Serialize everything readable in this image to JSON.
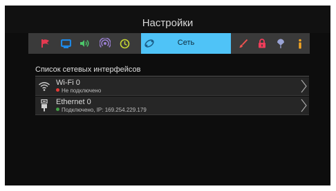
{
  "header": {
    "title": "Настройки"
  },
  "tabs": {
    "active_label": "Сеть",
    "items": [
      {
        "icon": "flag-icon",
        "color": "#e53950"
      },
      {
        "icon": "monitor-icon",
        "color": "#1e88e5"
      },
      {
        "icon": "volume-icon",
        "color": "#4cc86a"
      },
      {
        "icon": "broadcast-icon",
        "color": "#9a7fd1"
      },
      {
        "icon": "clock-icon",
        "color": "#c8d832"
      },
      {
        "icon": "network-icon",
        "color": "#1b5f8a",
        "active": true
      },
      {
        "icon": "brush-icon",
        "color": "#ef5350"
      },
      {
        "icon": "lock-icon",
        "color": "#ef3d5a"
      },
      {
        "icon": "balloon-icon",
        "color": "#9aa4d6"
      },
      {
        "icon": "info-icon",
        "color": "#f5a623"
      }
    ],
    "active_color": "#4fc3f7",
    "bar_color": "#3a3a3a"
  },
  "section": {
    "title": "Список сетевых интерфейсов"
  },
  "interfaces": [
    {
      "icon": "wifi-icon",
      "name": "Wi-Fi 0",
      "status": "Не подключено",
      "status_color": "#e53935"
    },
    {
      "icon": "ethernet-icon",
      "name": "Ethernet 0",
      "status": "Подключено, IP: 169.254.229.179",
      "status_color": "#43a047"
    }
  ]
}
